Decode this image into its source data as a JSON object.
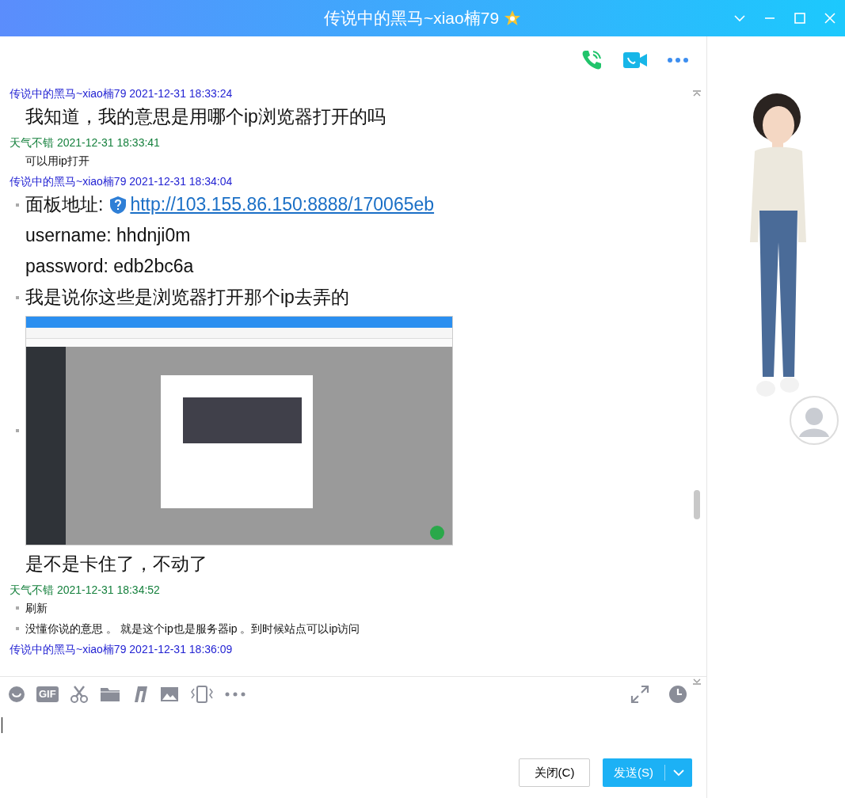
{
  "window": {
    "title": "传说中的黑马~xiao楠79"
  },
  "messages": [
    {
      "sender": "传说中的黑马~xiao楠79",
      "time": "2021-12-31 18:33:24",
      "color": "#1f1fd2",
      "items": [
        {
          "kind": "text",
          "large": true,
          "bullet": false,
          "text": "我知道，我的意思是用哪个ip浏览器打开的吗"
        }
      ]
    },
    {
      "sender": "天气不错",
      "time": "2021-12-31 18:33:41",
      "color": "#15803d",
      "items": [
        {
          "kind": "text",
          "large": false,
          "bullet": false,
          "text": "可以用ip打开"
        }
      ]
    },
    {
      "sender": "传说中的黑马~xiao楠79",
      "time": "2021-12-31 18:34:04",
      "color": "#1f1fd2",
      "items": [
        {
          "kind": "link",
          "large": true,
          "bullet": true,
          "text": "面板地址:",
          "url": "http://103.155.86.150:8888/170065eb"
        },
        {
          "kind": "text",
          "large": true,
          "bullet": false,
          "text": "username: hhdnji0m"
        },
        {
          "kind": "text",
          "large": true,
          "bullet": false,
          "text": "password: edb2bc6a"
        },
        {
          "kind": "text",
          "large": true,
          "bullet": true,
          "text": "我是说你这些是浏览器打开那个ip去弄的"
        },
        {
          "kind": "image",
          "large": true,
          "bullet": true
        },
        {
          "kind": "text",
          "large": true,
          "bullet": false,
          "text": "是不是卡住了，不动了"
        }
      ]
    },
    {
      "sender": "天气不错",
      "time": "2021-12-31 18:34:52",
      "color": "#15803d",
      "items": [
        {
          "kind": "text",
          "large": false,
          "bullet": true,
          "text": "刷新"
        },
        {
          "kind": "text",
          "large": false,
          "bullet": true,
          "text": "没懂你说的意思 。  就是这个ip也是服务器ip  。到时候站点可以ip访问"
        }
      ]
    },
    {
      "sender": "传说中的黑马~xiao楠79",
      "time": "2021-12-31 18:36:09",
      "color": "#1f1fd2"
    }
  ],
  "toolbar": {
    "gif_label": "GIF"
  },
  "buttons": {
    "close": "关闭(C)",
    "send": "发送(S)"
  }
}
